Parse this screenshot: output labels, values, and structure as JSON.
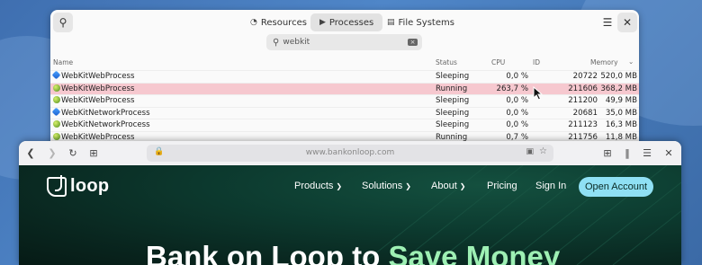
{
  "sysmon": {
    "tabs": [
      {
        "label": "Resources",
        "icon": "gauge-icon"
      },
      {
        "label": "Processes",
        "icon": "play-icon"
      },
      {
        "label": "File Systems",
        "icon": "disk-icon"
      }
    ],
    "search_value": "webkit",
    "columns": {
      "name": "Name",
      "status": "Status",
      "cpu": "CPU",
      "id": "ID",
      "memory": "Memory"
    },
    "processes": [
      {
        "name": "WebKitWebProcess",
        "status": "Sleeping",
        "cpu": "0,0 %",
        "id": "20722",
        "memory": "520,0 MB",
        "icon": "blue"
      },
      {
        "name": "WebKitWebProcess",
        "status": "Running",
        "cpu": "263,7 %",
        "id": "211606",
        "memory": "368,2 MB",
        "icon": "green"
      },
      {
        "name": "WebKitWebProcess",
        "status": "Sleeping",
        "cpu": "0,0 %",
        "id": "211200",
        "memory": "49,9 MB",
        "icon": "green"
      },
      {
        "name": "WebKitNetworkProcess",
        "status": "Sleeping",
        "cpu": "0,0 %",
        "id": "20681",
        "memory": "35,0 MB",
        "icon": "blue"
      },
      {
        "name": "WebKitNetworkProcess",
        "status": "Sleeping",
        "cpu": "0,0 %",
        "id": "211123",
        "memory": "16,3 MB",
        "icon": "green"
      },
      {
        "name": "WebKitWebProcess",
        "status": "Running",
        "cpu": "0,7 %",
        "id": "211756",
        "memory": "11,8 MB",
        "icon": "green"
      }
    ]
  },
  "browser": {
    "url": "www.bankonloop.com"
  },
  "site": {
    "logo_text": "loop",
    "nav": [
      {
        "label": "Products",
        "dropdown": true
      },
      {
        "label": "Solutions",
        "dropdown": true
      },
      {
        "label": "About",
        "dropdown": true
      },
      {
        "label": "Pricing",
        "dropdown": false
      },
      {
        "label": "Sign In",
        "dropdown": false
      }
    ],
    "cta": "Open Account",
    "hero_main": "Bank on Loop to ",
    "hero_accent": "Save Money"
  }
}
